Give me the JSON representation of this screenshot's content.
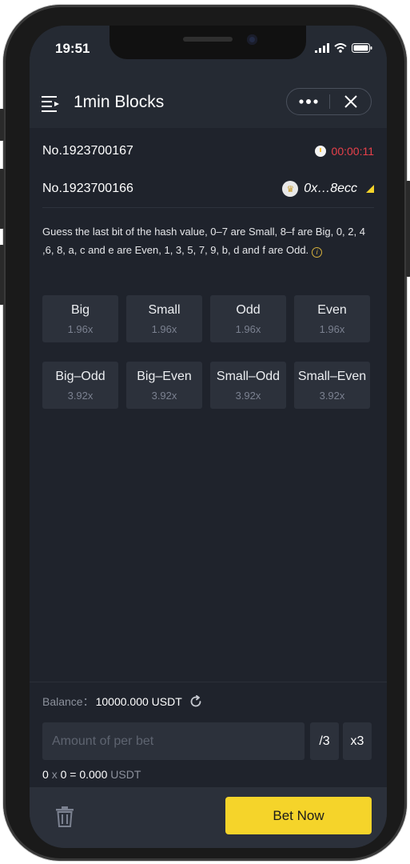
{
  "statusbar": {
    "time": "19:51"
  },
  "header": {
    "title": "1min Blocks"
  },
  "rounds": {
    "current": {
      "number": "No.1923700167",
      "countdown": "00:00:11"
    },
    "previous": {
      "number": "No.1923700166",
      "hash": "0x…8ecc"
    }
  },
  "description": "Guess the last bit of the hash value, 0–7 are Small, 8–f are Big, 0, 2, 4 ,6, 8, a, c and e are Even, 1, 3, 5, 7, 9, b, d and f are Odd.",
  "options_row1": [
    {
      "label": "Big",
      "odds": "1.96x"
    },
    {
      "label": "Small",
      "odds": "1.96x"
    },
    {
      "label": "Odd",
      "odds": "1.96x"
    },
    {
      "label": "Even",
      "odds": "1.96x"
    }
  ],
  "options_row2": [
    {
      "label": "Big–Odd",
      "odds": "3.92x"
    },
    {
      "label": "Big–Even",
      "odds": "3.92x"
    },
    {
      "label": "Small–Odd",
      "odds": "3.92x"
    },
    {
      "label": "Small–Even",
      "odds": "3.92x"
    }
  ],
  "bet": {
    "balance_label": "Balance：",
    "balance_value": "10000.000 USDT",
    "amount_placeholder": "Amount of per bet",
    "divide_label": "/3",
    "multiply_label": "x3",
    "formula": {
      "a": "0",
      "op1": "x",
      "b": "0",
      "op2": "=",
      "total": "0.000",
      "unit": "USDT"
    }
  },
  "footer": {
    "bet_button": "Bet Now"
  },
  "colors": {
    "accent": "#f5d42a",
    "countdown": "#e8404a",
    "background": "#1f232c"
  }
}
